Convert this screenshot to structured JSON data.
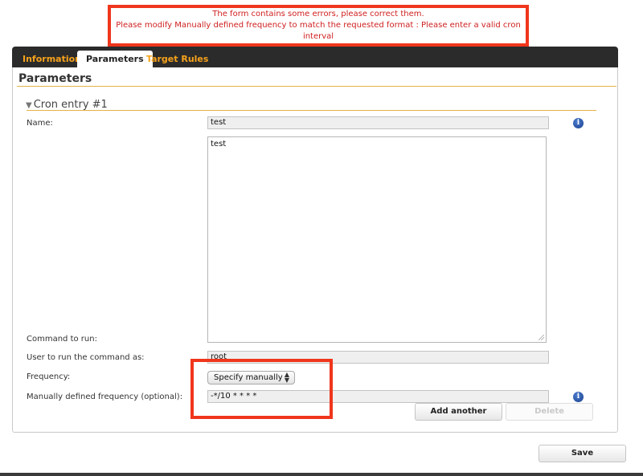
{
  "errors": {
    "line1": "The form contains some errors, please correct them.",
    "line2": "Please modify Manually defined frequency to match the requested format : Please enter a valid cron interval"
  },
  "tabs": [
    {
      "label": "Information",
      "active": false
    },
    {
      "label": "Parameters",
      "active": true
    },
    {
      "label": "Target Rules",
      "active": false
    }
  ],
  "panel": {
    "title": "Parameters",
    "section_title": "Cron entry #1"
  },
  "form": {
    "name_label": "Name:",
    "name_value": "test",
    "command_label": "Command to run:",
    "command_value": "test",
    "user_label": "User to run the command as:",
    "user_value": "root",
    "frequency_label": "Frequency:",
    "frequency_value": "Specify manually",
    "manual_label": "Manually defined frequency (optional):",
    "manual_value": "-*/10 * * * *"
  },
  "buttons": {
    "add_another": "Add another",
    "delete": "Delete",
    "save": "Save"
  },
  "colors": {
    "accent": "#f7a21b",
    "error": "#f0361c",
    "tabbar": "#2b2b2b"
  },
  "icons": {
    "info": "info-icon",
    "collapse": "triangle-down-icon"
  }
}
